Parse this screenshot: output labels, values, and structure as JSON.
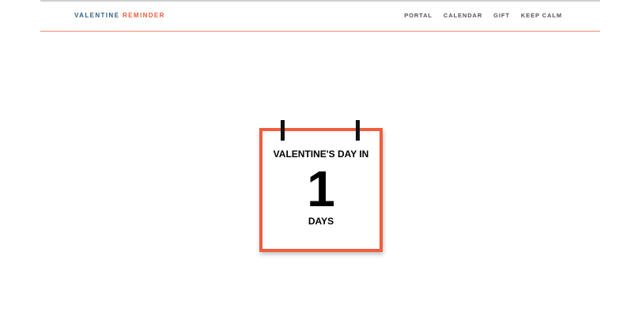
{
  "header": {
    "brand_part1": "VALENTINE",
    "brand_part2": "REMINDER",
    "nav": [
      "PORTAL",
      "CALENDAR",
      "GIFT",
      "KEEP CALM"
    ]
  },
  "countdown": {
    "title": "VALENTINE'S DAY IN",
    "value": "1",
    "unit": "DAYS"
  },
  "colors": {
    "accent": "#f05d3d",
    "brand_blue": "#2f5f86",
    "header_rule": "#ef8a72"
  }
}
